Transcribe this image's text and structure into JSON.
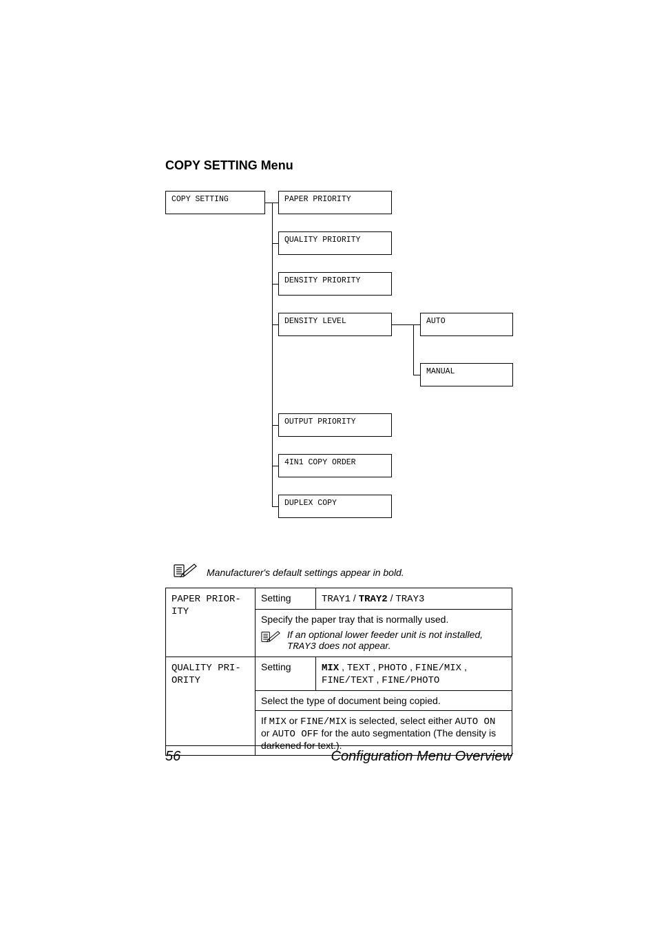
{
  "heading": "COPY SETTING Menu",
  "diagram": {
    "root": "COPY SETTING",
    "col2": [
      "PAPER PRIORITY",
      "QUALITY PRIORITY",
      "DENSITY PRIORITY",
      "DENSITY LEVEL",
      "OUTPUT PRIORITY",
      "4IN1 COPY ORDER",
      "DUPLEX COPY"
    ],
    "col3": [
      "AUTO",
      "MANUAL"
    ]
  },
  "note": "Manufacturer's default settings appear in bold.",
  "table": {
    "rows": [
      {
        "name_lines": [
          "PAPER PRIOR-",
          "ITY"
        ],
        "setting_label": "Setting",
        "setting_value_parts": [
          "TRAY1",
          " / ",
          "TRAY2",
          " / ",
          "TRAY3"
        ],
        "setting_bold_index": 2,
        "desc": "Specify the paper tray that is normally used.",
        "subnote_parts": [
          "If an optional lower feeder unit is not installed, ",
          "TRAY3",
          " does not appear."
        ]
      },
      {
        "name_lines": [
          "QUALITY PRI-",
          "ORITY"
        ],
        "setting_label": "Setting",
        "setting_value_parts": [
          "MIX",
          " , ",
          "TEXT",
          " , ",
          "PHOTO",
          " , ",
          "FINE/MIX",
          " , ",
          "FINE/TEXT",
          " , ",
          "FINE/PHOTO"
        ],
        "setting_bold_index": 0,
        "desc": "Select the type of document being copied.",
        "desc2_parts": [
          "If ",
          "MIX",
          " or ",
          "FINE/MIX",
          " is selected, select either ",
          "AUTO ON",
          " or ",
          "AUTO OFF",
          " for the auto segmentation (The density is darkened for text.)."
        ]
      }
    ]
  },
  "footer": {
    "page": "56",
    "title": "Configuration Menu Overview"
  }
}
